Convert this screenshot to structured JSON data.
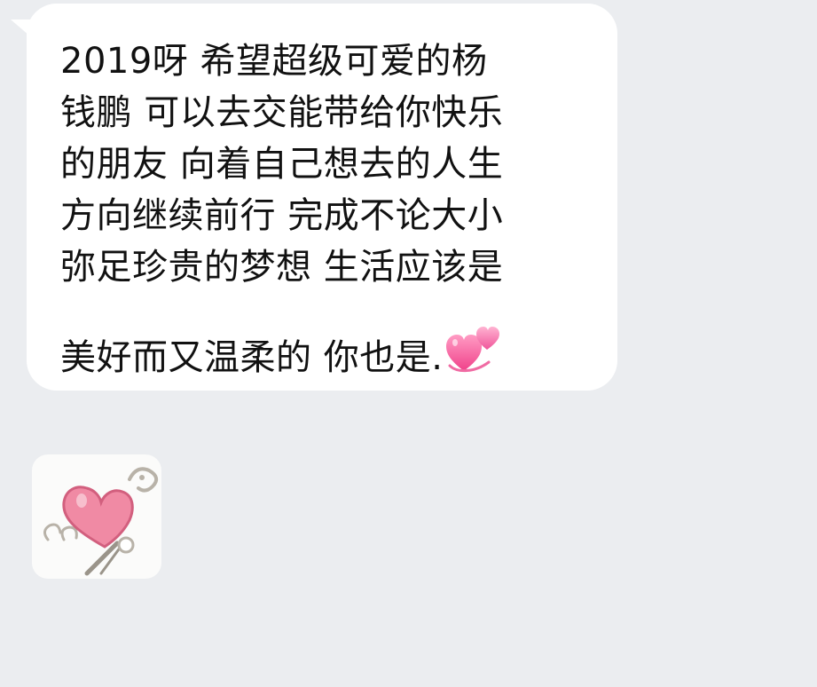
{
  "message": {
    "lines": [
      "2019呀 希望超级可爱的杨",
      "钱鹏 可以去交能带给你快乐",
      "的朋友 向着自己想去的人生",
      "方向继续前行 完成不论大小",
      "弥足珍贵的梦想 生活应该是",
      "美好而又温柔的 你也是."
    ],
    "emoji_icon": "two-hearts-icon"
  },
  "sticker": {
    "icon": "heart-wand-sticker-icon"
  },
  "colors": {
    "background": "#ebedf0",
    "bubble": "#ffffff",
    "text": "#111111",
    "heart_pink": "#f26a9c"
  }
}
